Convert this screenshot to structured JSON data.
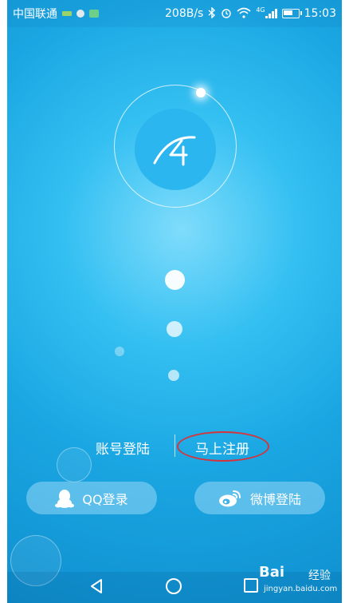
{
  "status_bar": {
    "carrier": "中国联通",
    "net_speed": "208B/s",
    "network_type": "4G",
    "time": "15:03",
    "icons": [
      "sim-icon",
      "settings-dot-icon",
      "app-icon",
      "bluetooth-icon",
      "alarm-icon",
      "wifi-icon",
      "signal-icon",
      "battery-icon"
    ]
  },
  "auth": {
    "account_login": "账号登陆",
    "register": "马上注册"
  },
  "social": {
    "qq_label": "QQ登录",
    "weibo_label": "微博登陆"
  },
  "watermark": {
    "brand": "Bai",
    "brand_cn": "经验",
    "url": "jingyan.baidu.com"
  },
  "colors": {
    "background": "#1aa6e2",
    "logo_disc": "#2cb6ef",
    "annotation_circle": "#d6343a"
  }
}
